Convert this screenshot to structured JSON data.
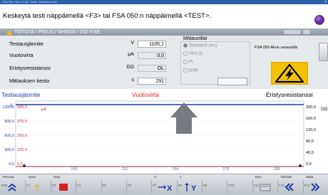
{
  "window": {
    "title": "FSA File / Test / Edit / Tools / Insulation test",
    "close": "×"
  },
  "instruction": "Keskeytä testi näppäimellä <F3> tai FSA 050:n näppäimellä <TEST>.",
  "vehicle": "TOYOTA / PRIUS / NHW20 / 1NZ-FXE",
  "readings": [
    {
      "label": "Testausjännite",
      "unit": "V",
      "value": "1105,1"
    },
    {
      "label": "Vuotovirta",
      "unit": "µA",
      "value": "0,0"
    },
    {
      "label": "Eristysresistanssi",
      "unit": "GΩ",
      "value": "OL"
    },
    {
      "label": "Mittauksen kesto",
      "unit": "s",
      "value": "291"
    }
  ],
  "mittaustilat": {
    "title": "Mittaustilat",
    "options": [
      "Standardi (Ins)",
      "Aika (t)",
      "PI",
      "DAR"
    ],
    "selected": 0
  },
  "status_text": "FSA 050 Akun varaustila",
  "chart_data": {
    "type": "line",
    "series_labels": {
      "left": "Testausjännite",
      "middle": "Vuotovirta",
      "right": "Eristysresistanssi"
    },
    "units": {
      "left": "V",
      "middle": "µA",
      "right": "GΩ"
    },
    "y_left_ticks": [
      "1200,0",
      "900,0",
      "600,0",
      "300,0",
      "0,0"
    ],
    "y_mid_ticks": [
      "500,0",
      "375,0",
      "250,0",
      "125,0",
      "0,0"
    ],
    "y_right_ticks": [
      "200,0",
      "160,0",
      "120,0",
      "80,0",
      "40,0",
      "0,0"
    ],
    "x_ticks": [
      "240",
      "252",
      "264",
      "276",
      "288"
    ],
    "colors": {
      "left": "#1e3aa8",
      "middle": "#d82020",
      "right": "#000000"
    }
  },
  "toolbar": [
    {
      "label": "Peruuta",
      "key": "ESC",
      "icon": "double-chevron-up-icon"
    },
    {
      "label": "Apua",
      "key": "F1",
      "icon": "help-icon"
    },
    {
      "label": "Stop",
      "key": "F3",
      "icon": "stop-icon"
    },
    {
      "label": "",
      "key": "F4",
      "icon": ""
    },
    {
      "label": "",
      "key": "F5",
      "icon": ""
    },
    {
      "label": "",
      "key": "F6",
      "icon": ""
    },
    {
      "label": "X",
      "key": "F7",
      "icon": "cursor-x-icon"
    },
    {
      "label": "Y",
      "key": "F8",
      "icon": "cursor-y-icon"
    },
    {
      "label": "",
      "key": "F9",
      "icon": ""
    },
    {
      "label": "",
      "key": "F10",
      "icon": ""
    },
    {
      "label": "DSA",
      "key": "F11",
      "icon": "dsa-icon"
    },
    {
      "label": "Takaisin",
      "key": "F12",
      "icon": "double-chevron-left-icon"
    },
    {
      "label": "Jatka",
      "key": "F13",
      "icon": "double-chevron-right-icon"
    }
  ]
}
